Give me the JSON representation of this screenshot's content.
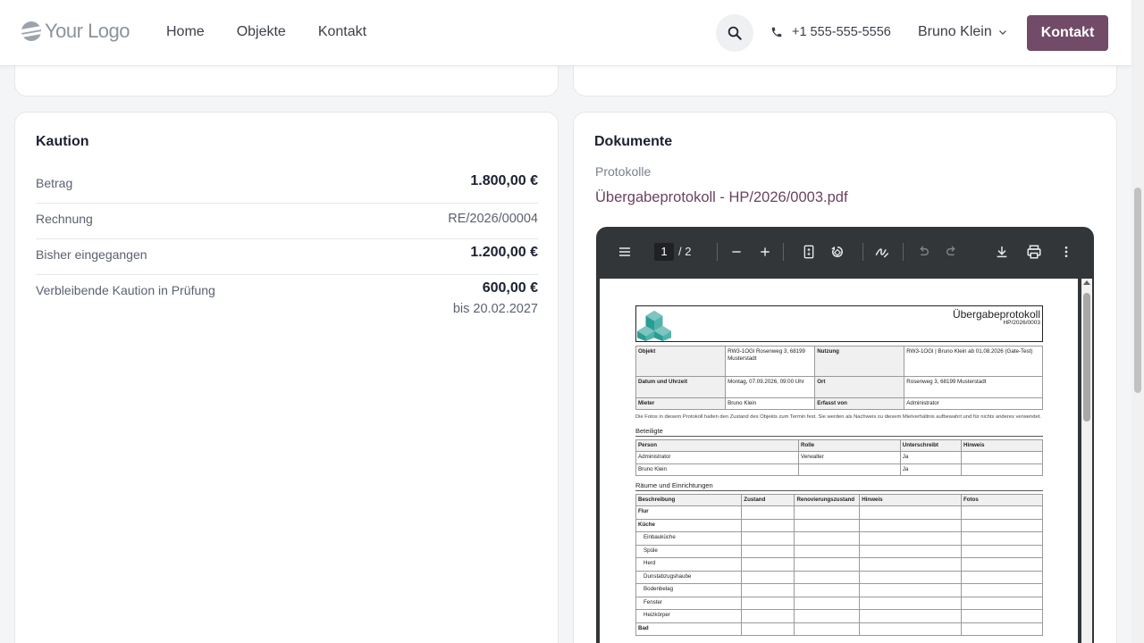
{
  "header": {
    "logo_text": "Your Logo",
    "nav": [
      {
        "label": "Home"
      },
      {
        "label": "Objekte"
      },
      {
        "label": "Kontakt"
      }
    ],
    "phone": "+1 555-555-5556",
    "user_name": "Bruno Klein",
    "cta_label": "Kontakt",
    "accent_color": "#714b67"
  },
  "deposit": {
    "title": "Kaution",
    "rows": [
      {
        "label": "Betrag",
        "value": "1.800,00 €"
      },
      {
        "label": "Rechnung",
        "value": "RE/2026/00004"
      },
      {
        "label": "Bisher eingegangen",
        "value": "1.200,00 €"
      },
      {
        "label": "Verbleibende Kaution in Prüfung",
        "value": "600,00 €",
        "sub": "bis 20.02.2027"
      }
    ]
  },
  "documents": {
    "title": "Dokumente",
    "section": "Protokolle",
    "file_link": "Übergabeprotokoll - HP/2026/0003.pdf"
  },
  "pdf_viewer": {
    "current_page": "1",
    "total_pages": "/ 2",
    "doc": {
      "title": "Übergabeprotokoll",
      "number": "HP/2026/0003",
      "info": {
        "objekt_label": "Objekt",
        "objekt_value": "RW3-1OGl Rosenweg 3, 68199 Musterstadt",
        "nutzung_label": "Nutzung",
        "nutzung_value": "RW3-1OGl | Bruno Klein ab 01.08.2026 (Gate-Test)",
        "datum_label": "Datum und Uhrzeit",
        "datum_value": "Montag, 07.09.2026, 09:00 Uhr",
        "ort_label": "Ort",
        "ort_value": "Rosenweg 3, 68199 Musterstadt",
        "mieter_label": "Mieter",
        "mieter_value": "Bruno Klein",
        "erfasst_label": "Erfasst von",
        "erfasst_value": "Administrator"
      },
      "note": "Die Fotos in diesem Protokoll halten den Zustand des Objekts zum Termin fest. Sie werden als Nachweis zu diesem Mietverhältnis aufbewahrt und für nichts anderes verwendet.",
      "participants_title": "Beteiligte",
      "participants_headers": [
        "Person",
        "Rolle",
        "Unterschreibt",
        "Hinweis"
      ],
      "participants": [
        [
          "Administrator",
          "Verwalter",
          "Ja",
          ""
        ],
        [
          "Bruno Klein",
          "",
          "Ja",
          ""
        ]
      ],
      "rooms_title": "Räume und Einrichtungen",
      "rooms_headers": [
        "Beschreibung",
        "Zustand",
        "Renovierungszustand",
        "Hinweis",
        "Fotos"
      ],
      "rooms": [
        {
          "name": "Flur",
          "bold": true
        },
        {
          "name": "Küche",
          "bold": true
        },
        {
          "name": "Einbauküche",
          "bold": false
        },
        {
          "name": "Spüle",
          "bold": false
        },
        {
          "name": "Herd",
          "bold": false
        },
        {
          "name": "Dunstabzugshaube",
          "bold": false
        },
        {
          "name": "Bodenbelag",
          "bold": false
        },
        {
          "name": "Fenster",
          "bold": false
        },
        {
          "name": "Heizkörper",
          "bold": false
        },
        {
          "name": "Bad",
          "bold": true
        }
      ]
    }
  }
}
